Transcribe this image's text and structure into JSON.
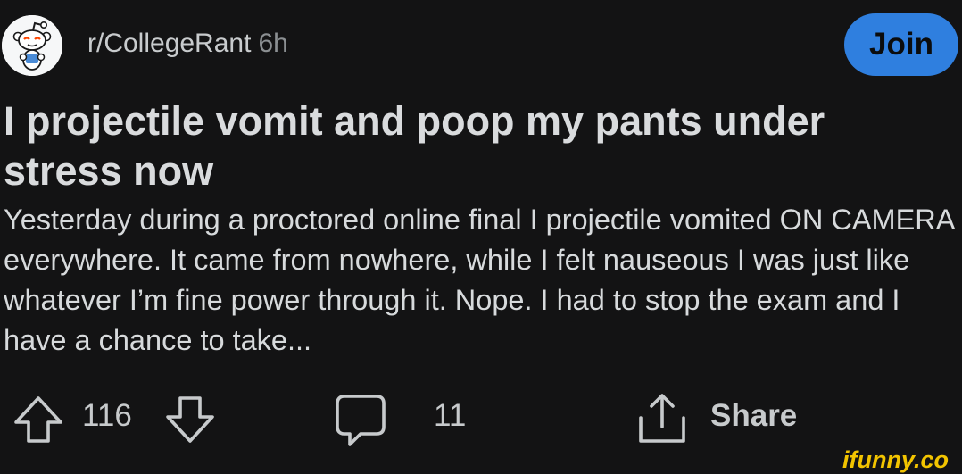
{
  "header": {
    "community": "r/CollegeRant",
    "time": "6h",
    "join_label": "Join"
  },
  "post": {
    "title": "I projectile vomit and poop my pants under stress now",
    "body": "Yesterday during a proctored online final I projectile vomited ON CAMERA everywhere. It came from nowhere, while I felt nauseous I was just like whatever I’m fine power through it. Nope. I had to stop the exam and I have a chance to take..."
  },
  "actions": {
    "vote_count": "116",
    "comment_count": "11",
    "share_label": "Share"
  },
  "icons": {
    "avatar": "snoo-avatar-icon",
    "upvote": "upvote-arrow-icon",
    "downvote": "downvote-arrow-icon",
    "comment": "comment-bubble-icon",
    "share": "share-icon"
  },
  "colors": {
    "background": "#131314",
    "join_button": "#2f7fdf",
    "text": "#d7dadc",
    "watermark": "#f2c400"
  },
  "watermark": "ifunny.co"
}
